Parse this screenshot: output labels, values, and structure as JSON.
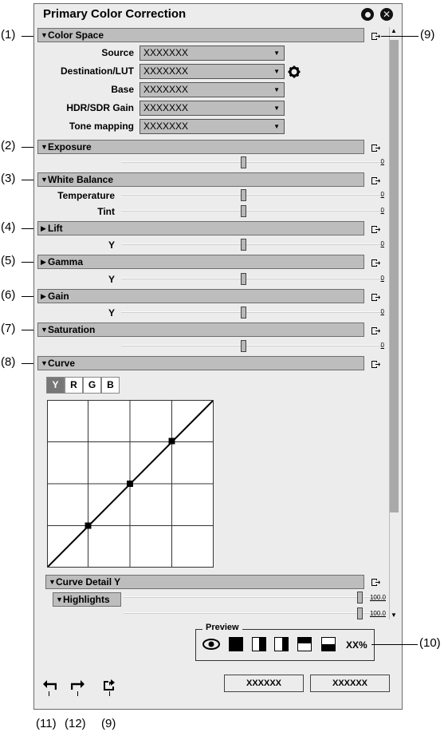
{
  "window": {
    "title": "Primary Color Correction"
  },
  "callouts": {
    "c1": "(1)",
    "c2": "(2)",
    "c3": "(3)",
    "c4": "(4)",
    "c5": "(5)",
    "c6": "(6)",
    "c7": "(7)",
    "c8": "(8)",
    "c9": "(9)",
    "c10": "(10)",
    "c11": "(11)",
    "c12": "(12)",
    "c9b": "(9)"
  },
  "sections": {
    "color_space": "Color Space",
    "exposure": "Exposure",
    "white_balance": "White Balance",
    "lift": "Lift",
    "gamma": "Gamma",
    "gain": "Gain",
    "saturation": "Saturation",
    "curve": "Curve",
    "curve_detail": "Curve Detail Y",
    "highlights": "Highlights"
  },
  "color_space": {
    "rows": [
      {
        "label": "Source",
        "value": "XXXXXXX"
      },
      {
        "label": "Destination/LUT",
        "value": "XXXXXXX"
      },
      {
        "label": "Base",
        "value": "XXXXXXX"
      },
      {
        "label": "HDR/SDR Gain",
        "value": "XXXXXXX"
      },
      {
        "label": "Tone mapping",
        "value": "XXXXXXX"
      }
    ]
  },
  "sliders": {
    "exposure": {
      "label": "",
      "value": "0"
    },
    "temperature": {
      "label": "Temperature",
      "value": "0"
    },
    "tint": {
      "label": "Tint",
      "value": "0"
    },
    "lift_y": {
      "label": "Y",
      "value": "0"
    },
    "gamma_y": {
      "label": "Y",
      "value": "0"
    },
    "gain_y": {
      "label": "Y",
      "value": "0"
    },
    "saturation": {
      "label": "",
      "value": "0"
    },
    "highlights_1": {
      "label": "",
      "value": "100.0"
    },
    "highlights_2": {
      "label": "",
      "value": "100.0"
    }
  },
  "curve_tabs": [
    "Y",
    "R",
    "G",
    "B"
  ],
  "preview": {
    "label": "Preview",
    "zoom": "XX%"
  },
  "buttons": {
    "ok": "XXXXXX",
    "cancel": "XXXXXX"
  },
  "colors": {
    "panel_bg": "#ececec",
    "header_bg": "#bdbdbd",
    "scroll_thumb": "#a9a9a9"
  }
}
